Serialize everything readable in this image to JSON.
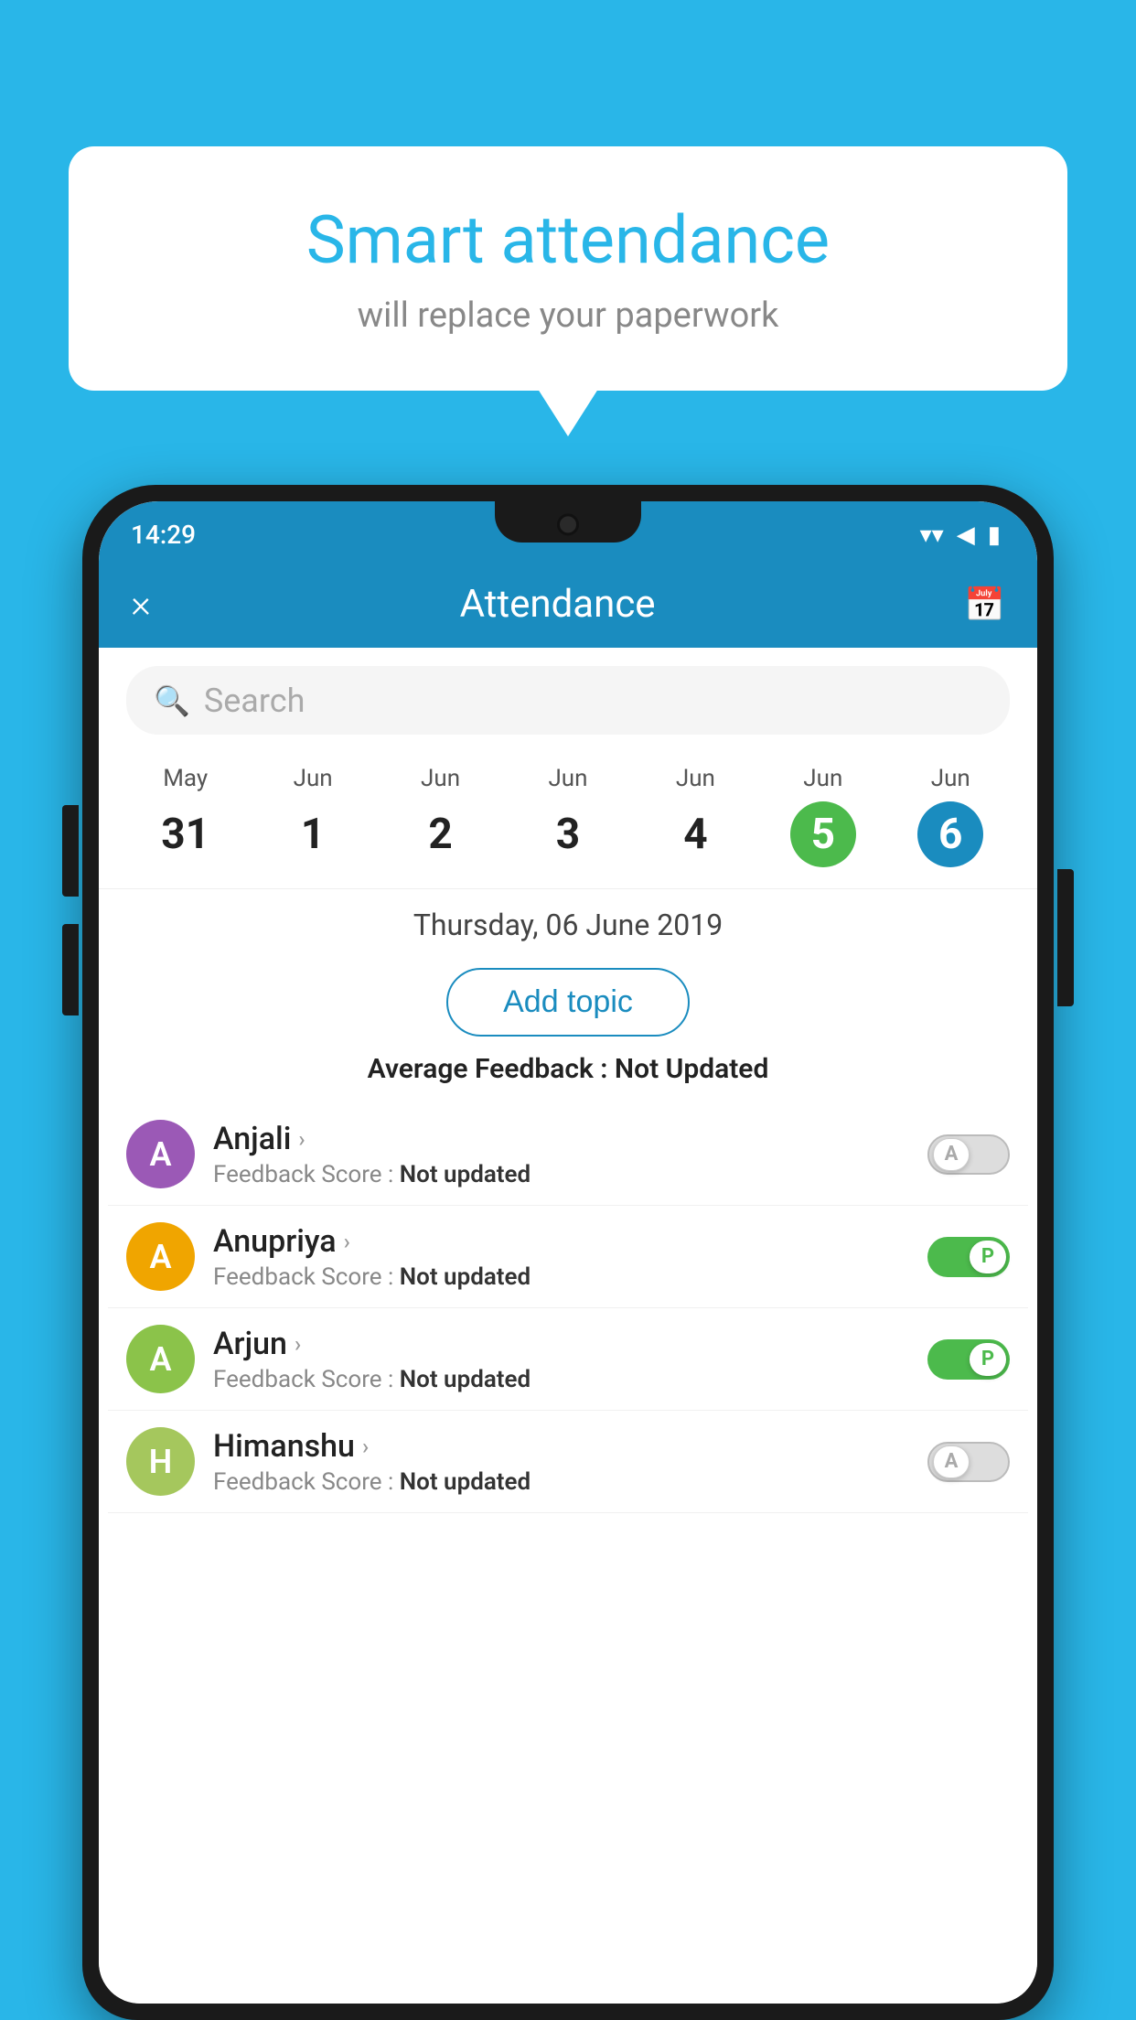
{
  "background_color": "#29b6e8",
  "bubble": {
    "title": "Smart attendance",
    "subtitle": "will replace your paperwork"
  },
  "status_bar": {
    "time": "14:29",
    "wifi": "▲",
    "signal": "▲",
    "battery": "▮"
  },
  "header": {
    "title": "Attendance",
    "close_label": "×",
    "calendar_icon": "📅"
  },
  "search": {
    "placeholder": "Search"
  },
  "calendar": {
    "days": [
      {
        "month": "May",
        "date": "31",
        "state": "normal"
      },
      {
        "month": "Jun",
        "date": "1",
        "state": "normal"
      },
      {
        "month": "Jun",
        "date": "2",
        "state": "normal"
      },
      {
        "month": "Jun",
        "date": "3",
        "state": "normal"
      },
      {
        "month": "Jun",
        "date": "4",
        "state": "normal"
      },
      {
        "month": "Jun",
        "date": "5",
        "state": "today"
      },
      {
        "month": "Jun",
        "date": "6",
        "state": "selected"
      }
    ],
    "selected_date_label": "Thursday, 06 June 2019"
  },
  "add_topic_label": "Add topic",
  "average_feedback": {
    "label": "Average Feedback :",
    "value": "Not Updated"
  },
  "students": [
    {
      "name": "Anjali",
      "initial": "A",
      "avatar_color": "#9b59b6",
      "feedback_label": "Feedback Score :",
      "feedback_value": "Not updated",
      "attendance": "absent",
      "toggle_label": "A"
    },
    {
      "name": "Anupriya",
      "initial": "A",
      "avatar_color": "#f0a500",
      "feedback_label": "Feedback Score :",
      "feedback_value": "Not updated",
      "attendance": "present",
      "toggle_label": "P"
    },
    {
      "name": "Arjun",
      "initial": "A",
      "avatar_color": "#8bc34a",
      "feedback_label": "Feedback Score :",
      "feedback_value": "Not updated",
      "attendance": "present",
      "toggle_label": "P"
    },
    {
      "name": "Himanshu",
      "initial": "H",
      "avatar_color": "#a5c75d",
      "feedback_label": "Feedback Score :",
      "feedback_value": "Not updated",
      "attendance": "absent",
      "toggle_label": "A"
    }
  ]
}
